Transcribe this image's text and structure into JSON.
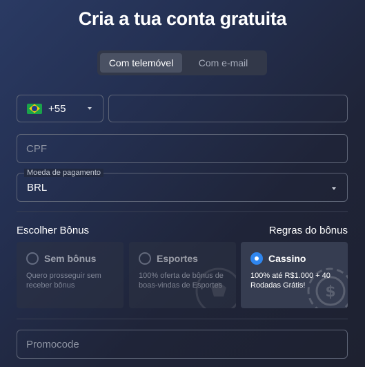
{
  "title": "Cria a tua conta gratuita",
  "tabs": [
    {
      "label": "Com telemóvel",
      "active": true
    },
    {
      "label": "Com e-mail",
      "active": false
    }
  ],
  "phone": {
    "country_code": "+55",
    "flag": "brazil-flag-icon",
    "value": ""
  },
  "cpf": {
    "placeholder": "CPF"
  },
  "currency": {
    "legend": "Moeda de pagamento",
    "value": "BRL"
  },
  "bonus": {
    "heading": "Escolher Bônus",
    "rules_link": "Regras do bônus",
    "options": [
      {
        "title": "Sem bônus",
        "description": "Quero prosseguir sem receber bônus",
        "selected": false
      },
      {
        "title": "Esportes",
        "description": "100% oferta de bônus de boas-vindas de Esportes",
        "selected": false
      },
      {
        "title": "Cassino",
        "description": "100% até R$1.000 + 40 Rodadas Grátis!",
        "selected": true
      }
    ]
  },
  "promocode": {
    "placeholder": "Promocode"
  },
  "colors": {
    "accent": "#2f86ef",
    "border": "#5e6577",
    "card": "#2d3344"
  }
}
